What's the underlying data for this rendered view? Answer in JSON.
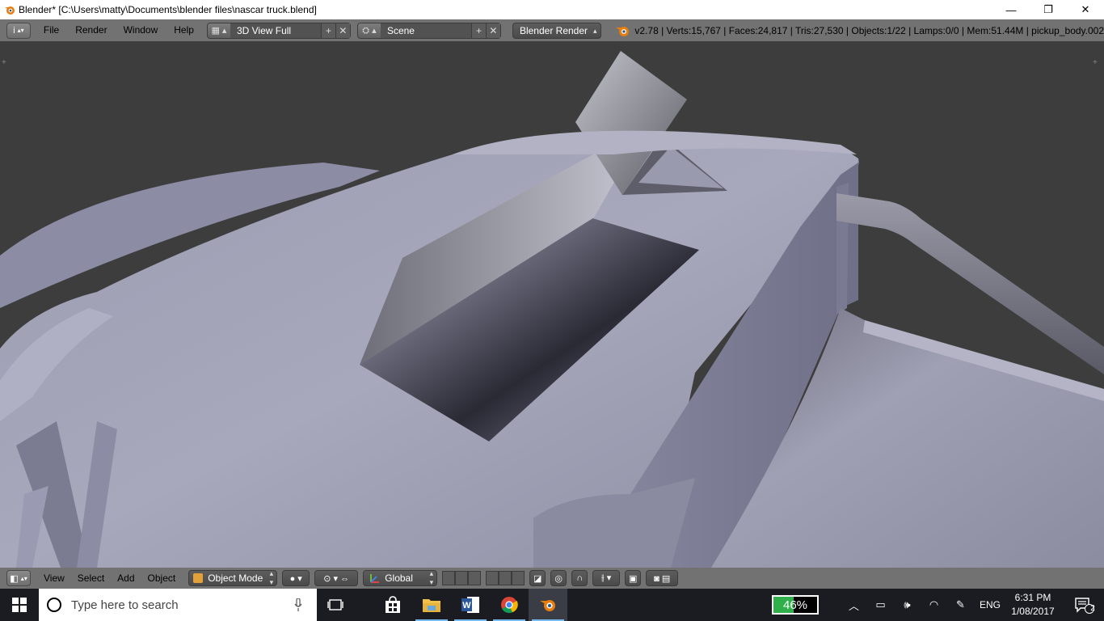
{
  "window": {
    "title": "Blender* [C:\\Users\\matty\\Documents\\blender files\\nascar truck.blend]",
    "controls": {
      "minimize": "—",
      "restore": "❐",
      "close": "✕"
    }
  },
  "info_header": {
    "editor_icon": "i",
    "menus": [
      "File",
      "Render",
      "Window",
      "Help"
    ],
    "screen_layout": "3D View Full",
    "scene": "Scene",
    "render_engine": "Blender Render",
    "stats": "v2.78 | Verts:15,767 | Faces:24,817 | Tris:27,530 | Objects:1/22 | Lamps:0/0 | Mem:51.44M | pickup_body.002"
  },
  "view3d_header": {
    "menus": [
      "View",
      "Select",
      "Add",
      "Object"
    ],
    "mode": "Object Mode",
    "transform_orientation": "Global"
  },
  "taskbar": {
    "search_placeholder": "Type here to search",
    "battery_percent": "46%",
    "battery_level": 0.46,
    "language": "ENG",
    "time": "6:31 PM",
    "date": "1/08/2017",
    "notification_count": "2",
    "apps": [
      "task-view",
      "store",
      "file-explorer",
      "word",
      "chrome",
      "blender"
    ]
  },
  "colors": {
    "viewport_bg": "#3d3d3d",
    "header_bg": "#727272",
    "model_base": "#a3a3b8",
    "taskbar_bg": "#1a1c22"
  }
}
